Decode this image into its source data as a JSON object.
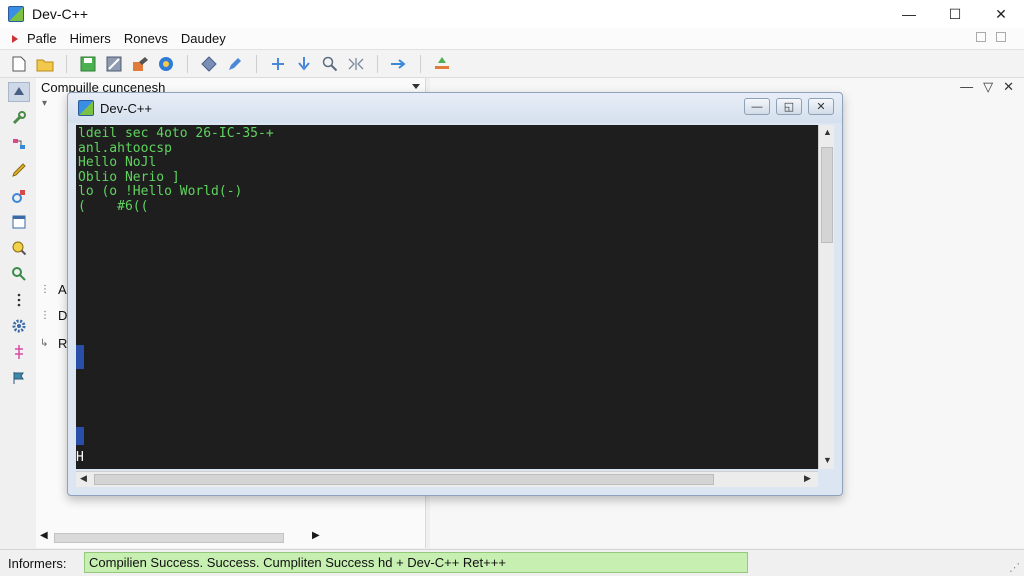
{
  "window": {
    "title": "Dev-C++",
    "controls": [
      "—",
      "☐",
      "✕"
    ]
  },
  "menu": {
    "items": [
      "Pafle",
      "Himers",
      "Ronevs",
      "Daudey"
    ]
  },
  "toolbar": {
    "icons": [
      "new-file-icon",
      "open-folder-icon",
      "save-icon",
      "save-all-icon",
      "compile-icon",
      "run-icon",
      "debug-icon",
      "edit-icon",
      "move-icon",
      "down-arrow-icon",
      "zoom-icon",
      "split-icon",
      "forward-icon",
      "build-icon"
    ]
  },
  "left_panel": {
    "combo_value": "Compuille cuncenesh",
    "tree": [
      "A",
      "D",
      "R"
    ]
  },
  "console_window": {
    "title": "Dev-C++",
    "lines": [
      "ldeil sec 4oto 26-IC-35-+",
      "anl.ahtoocsp",
      "Hello NoJl",
      "Oblio Nerio ]",
      "lo (o !Hello World(-)",
      "(    #6(("
    ],
    "prompt": "H"
  },
  "statusbar": {
    "label": "Informers:",
    "message": "Compilien Success. Success. Cumpliten Success hd + Dev-C++ Ret+++"
  },
  "colors": {
    "console_bg": "#1e1e1e",
    "console_text": "#5fd35f",
    "status_success": "#c6efb1"
  }
}
